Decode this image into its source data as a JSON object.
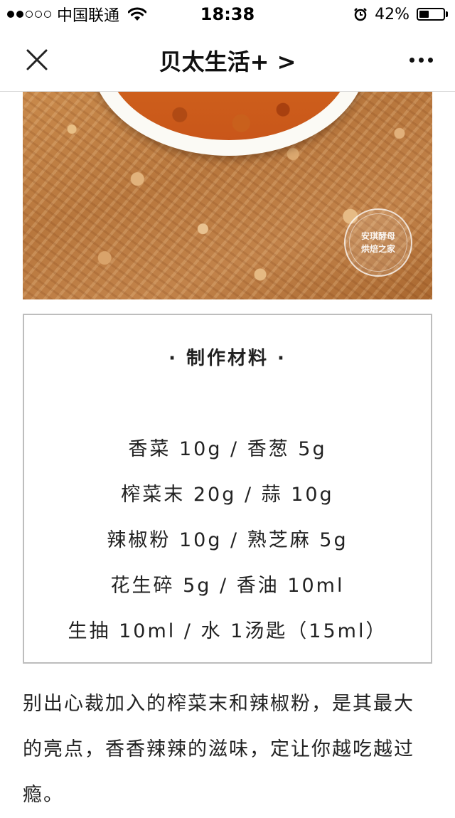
{
  "status_bar": {
    "carrier": "中国联通",
    "time": "18:38",
    "battery_percent": "42%",
    "battery_level": 0.42,
    "signal_bars_filled": 2,
    "signal_bars_total": 5
  },
  "nav": {
    "title": "贝太生活+ >",
    "close_icon": "close-icon",
    "more_icon": "more-icon"
  },
  "hero": {
    "watermark_line1": "安琪酵母",
    "watermark_line2": "烘焙之家"
  },
  "ingredients": {
    "title": "· 制作材料 ·",
    "lines": [
      "香菜 10g / 香葱 5g",
      "榨菜末 20g / 蒜 10g",
      "辣椒粉 10g / 熟芝麻 5g",
      "花生碎 5g / 香油 10ml",
      "生抽 10ml / 水 1汤匙（15ml）"
    ]
  },
  "description": "别出心裁加入的榨菜末和辣椒粉，是其最大的亮点，香香辣辣的滋味，定让你越吃越过瘾。"
}
